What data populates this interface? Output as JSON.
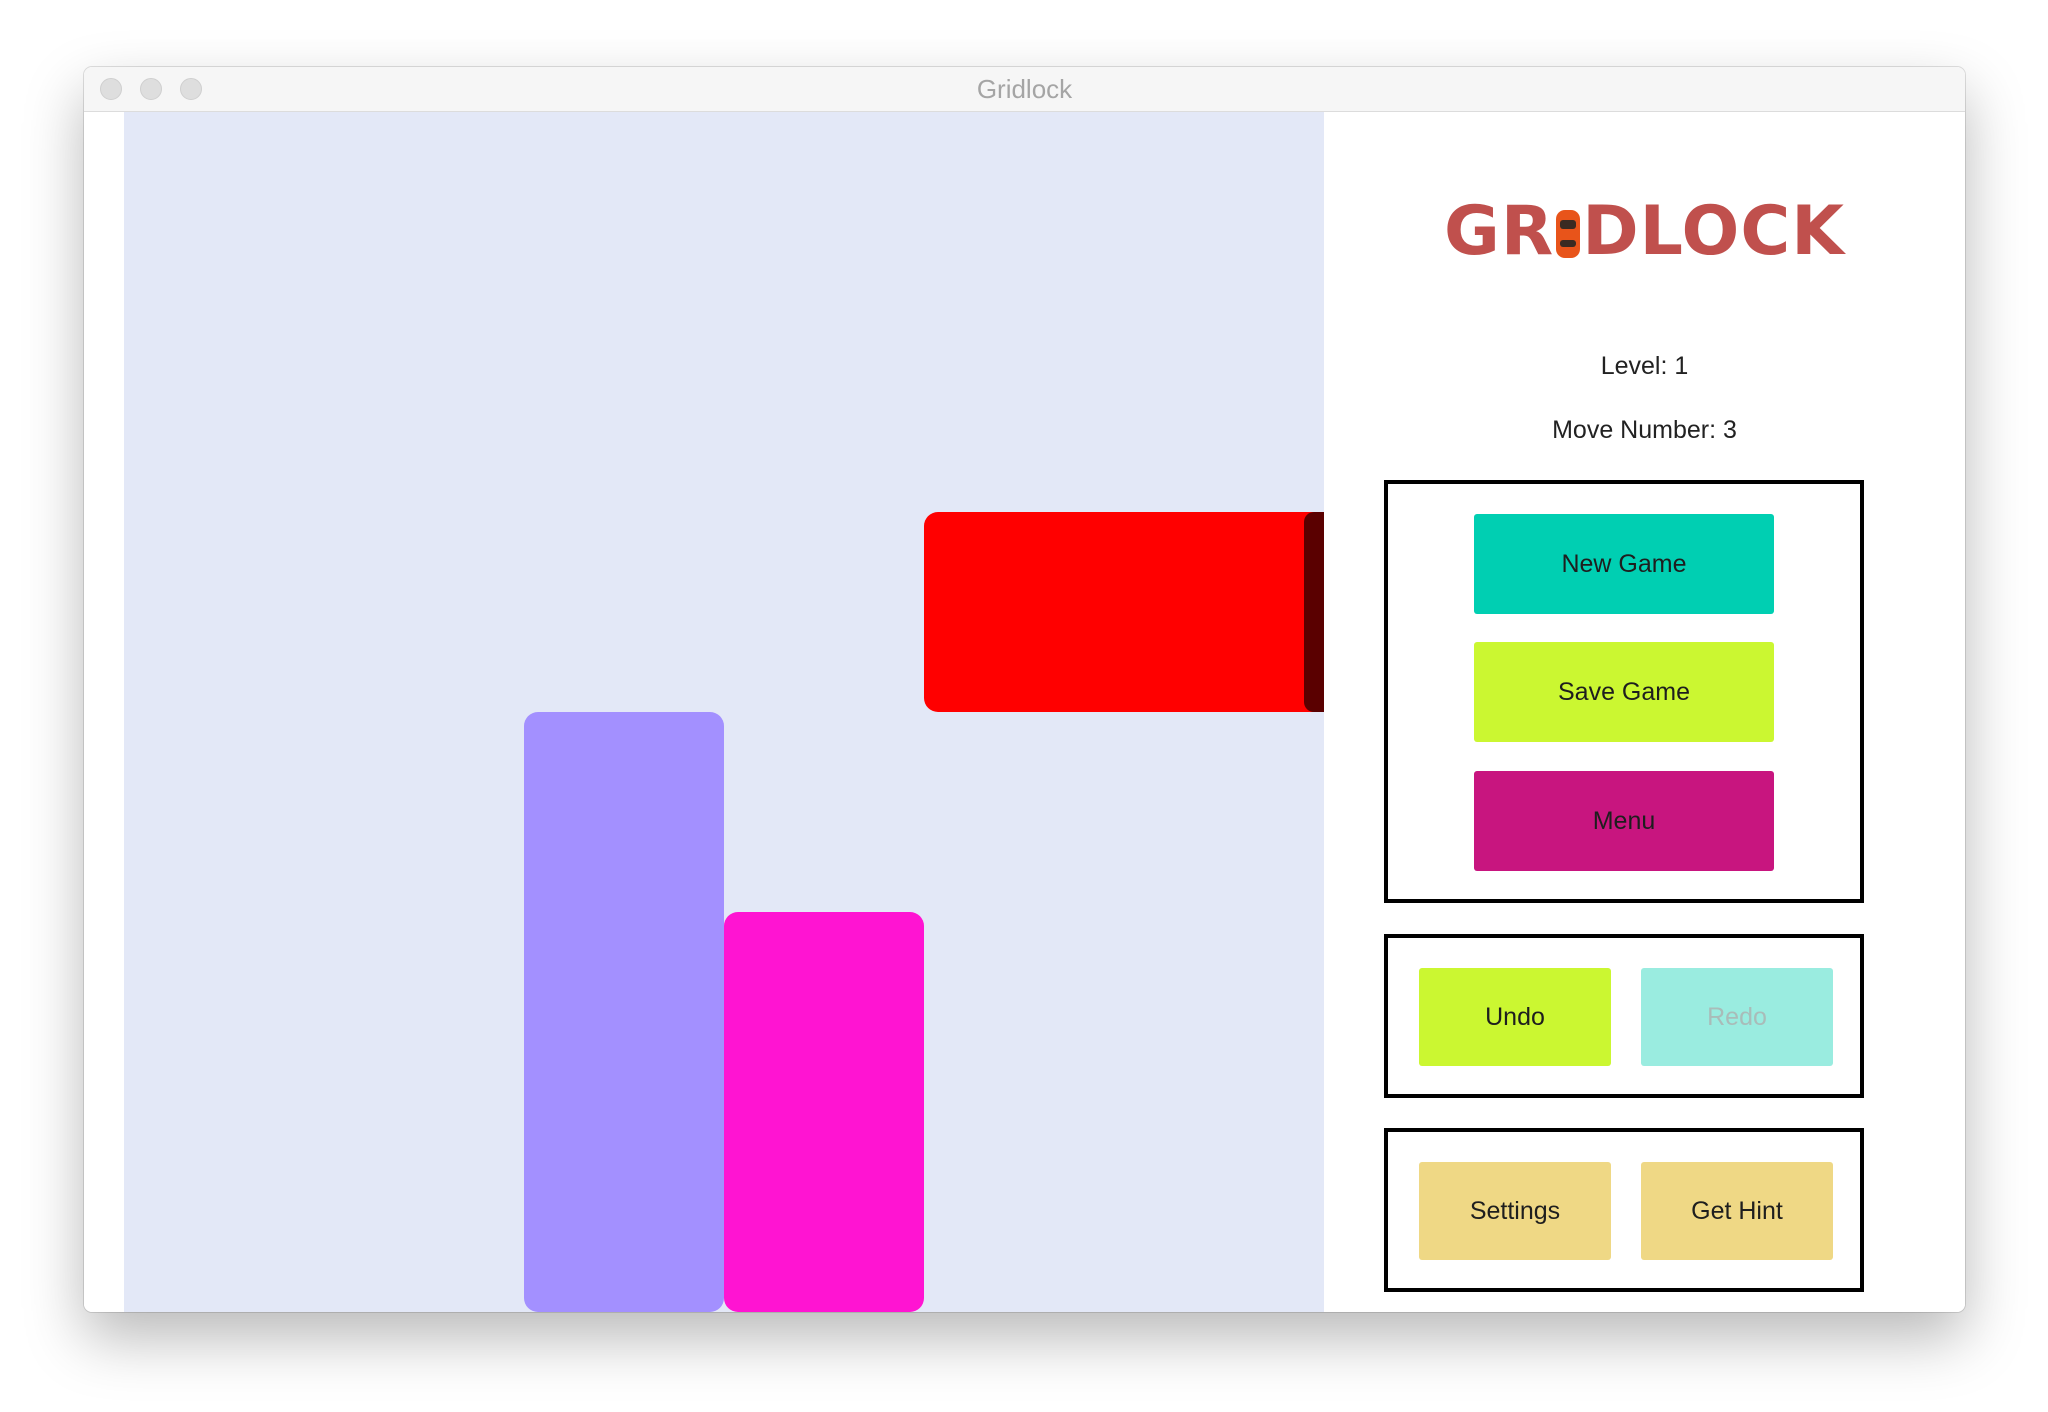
{
  "window": {
    "title": "Gridlock"
  },
  "board": {
    "cars": [
      {
        "name": "red-car",
        "color": "#ff0000"
      },
      {
        "name": "purple-car",
        "color": "#a390ff"
      },
      {
        "name": "magenta-car",
        "color": "#ff14d2"
      }
    ],
    "background": "#e3e8f7"
  },
  "sidebar": {
    "logo": {
      "text_before": "GR",
      "text_after": "DLOCK",
      "icon": "car-icon",
      "color": "#c0504d"
    },
    "level_text": "Level: 1",
    "move_text": "Move Number: 3",
    "buttons": {
      "new_game": "New Game",
      "save_game": "Save Game",
      "menu": "Menu",
      "undo": "Undo",
      "redo": "Redo",
      "settings": "Settings",
      "get_hint": "Get Hint"
    },
    "button_colors": {
      "new_game": "#00cfb2",
      "save_game": "#cbf731",
      "menu": "#c8157f",
      "undo": "#cbf731",
      "redo": "#9aece0",
      "settings": "#efd885",
      "get_hint": "#efd885"
    }
  }
}
